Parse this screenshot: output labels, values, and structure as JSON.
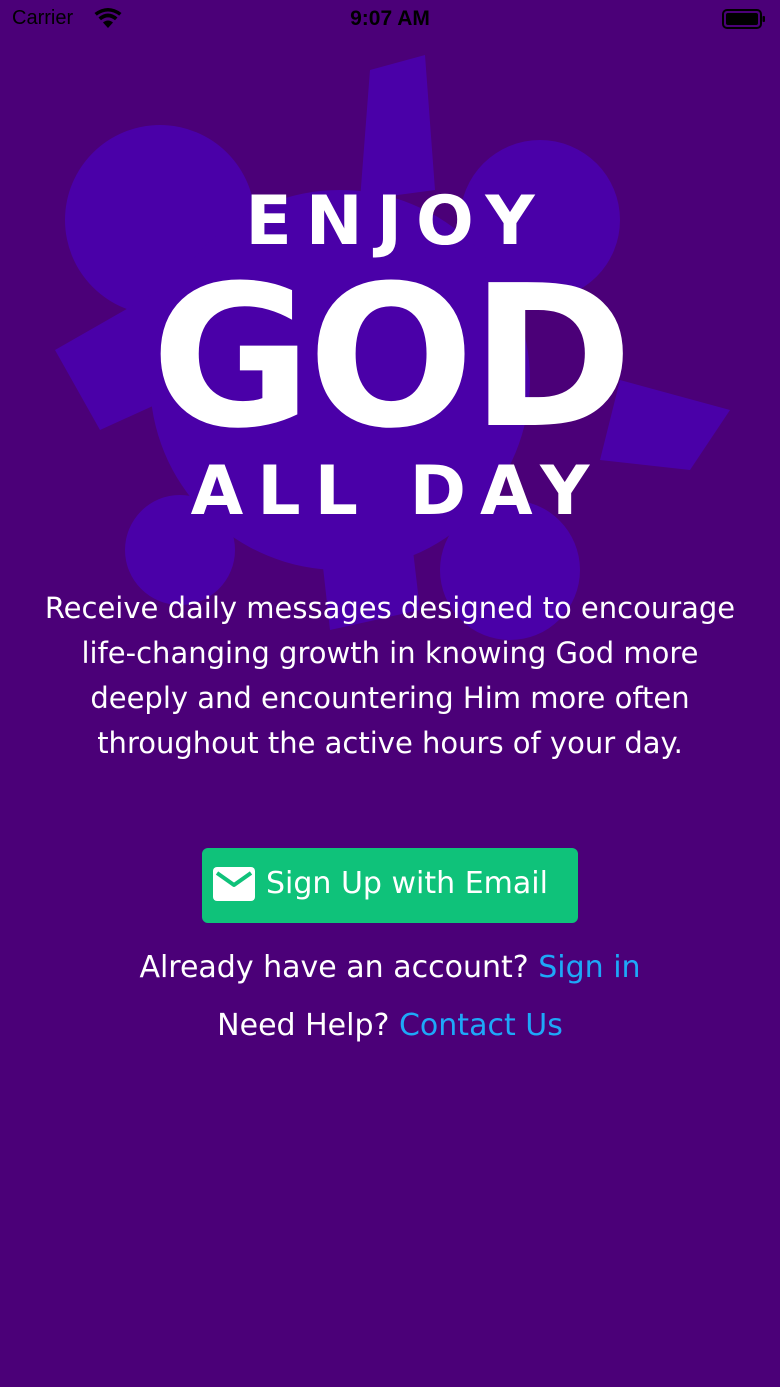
{
  "colors": {
    "background": "#4B0078",
    "logo_shape": "#4A00A8",
    "accent_green": "#0FC27A",
    "link_blue": "#1EA8F8",
    "status_text": "#000000"
  },
  "status_bar": {
    "carrier": "Carrier",
    "time": "9:07 AM",
    "wifi_icon": "wifi-icon",
    "battery_icon": "battery-icon"
  },
  "logo": {
    "line1": "ENJOY",
    "line2": "GOD",
    "line3": "ALL DAY"
  },
  "description": "Receive daily messages designed to encourage life-changing growth in knowing God more deeply and encountering Him more often throughout the active hours of your day.",
  "signup": {
    "label": "Sign Up with Email",
    "icon": "mail-icon"
  },
  "signin_row": {
    "prompt": "Already have an account?",
    "link": "Sign in"
  },
  "help_row": {
    "prompt": "Need Help?",
    "link": "Contact Us"
  }
}
